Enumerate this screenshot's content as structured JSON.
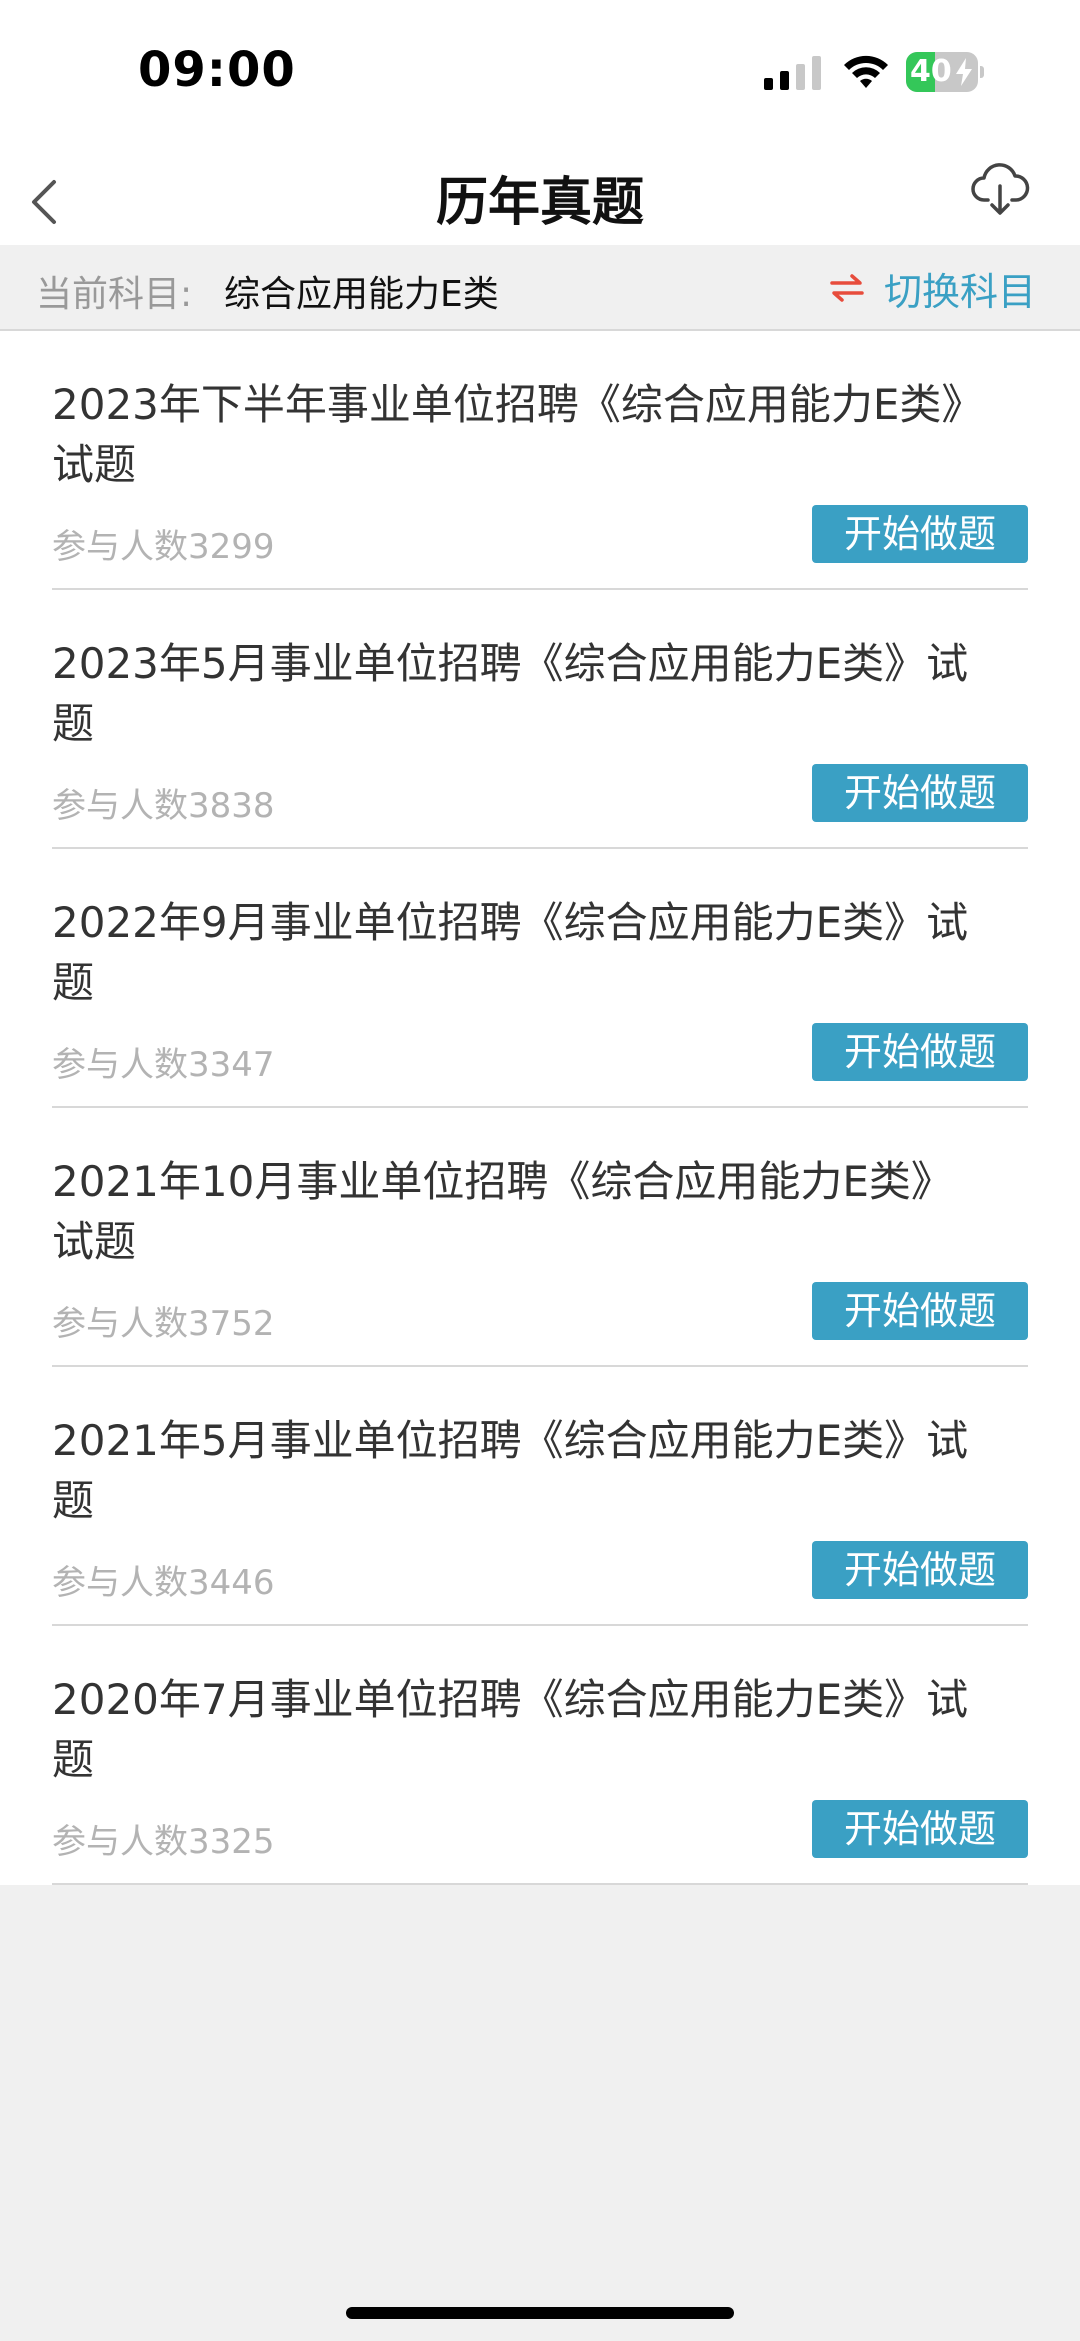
{
  "status_bar": {
    "time": "09:00",
    "battery_level": "40",
    "battery_fraction": 0.4
  },
  "nav": {
    "title": "历年真题",
    "back_icon": "chevron-left-icon",
    "download_icon": "cloud-download-icon"
  },
  "subject": {
    "label": "当前科目:",
    "value": "综合应用能力E类",
    "switch_label": "切换科目",
    "switch_icon": "swap-arrows-icon"
  },
  "exams": [
    {
      "title": "2023年下半年事业单位招聘《综合应用能力E类》试题",
      "count": "参与人数3299",
      "button": "开始做题"
    },
    {
      "title": "2023年5月事业单位招聘《综合应用能力E类》试题",
      "count": "参与人数3838",
      "button": "开始做题"
    },
    {
      "title": "2022年9月事业单位招聘《综合应用能力E类》试题",
      "count": "参与人数3347",
      "button": "开始做题"
    },
    {
      "title": "2021年10月事业单位招聘《综合应用能力E类》试题",
      "count": "参与人数3752",
      "button": "开始做题"
    },
    {
      "title": "2021年5月事业单位招聘《综合应用能力E类》试题",
      "count": "参与人数3446",
      "button": "开始做题"
    },
    {
      "title": "2020年7月事业单位招聘《综合应用能力E类》试题",
      "count": "参与人数3325",
      "button": "开始做题"
    }
  ],
  "colors": {
    "accent": "#3aa0c4",
    "switch_icon": "#e74c3c",
    "battery": "#34c759"
  }
}
